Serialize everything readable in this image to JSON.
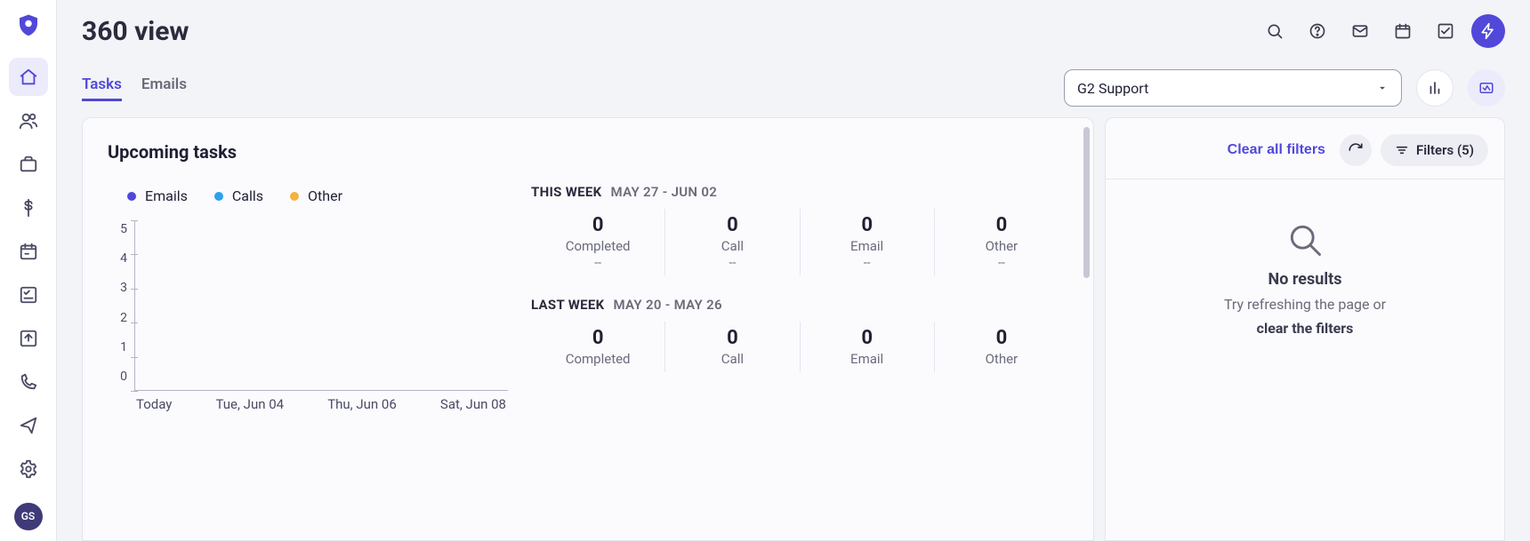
{
  "header": {
    "title": "360 view"
  },
  "avatar": {
    "initials": "GS"
  },
  "tabs": [
    {
      "id": "tasks",
      "label": "Tasks",
      "active": true
    },
    {
      "id": "emails",
      "label": "Emails",
      "active": false
    }
  ],
  "selector": {
    "value": "G2 Support"
  },
  "upcoming": {
    "title": "Upcoming tasks",
    "legend": {
      "emails": {
        "label": "Emails",
        "color": "#5148d9"
      },
      "calls": {
        "label": "Calls",
        "color": "#29a3ef"
      },
      "other": {
        "label": "Other",
        "color": "#f4b23e"
      }
    },
    "yticks": [
      "5",
      "4",
      "3",
      "2",
      "1",
      "0"
    ],
    "xlabels": [
      "Today",
      "Tue, Jun 04",
      "Thu, Jun 06",
      "Sat, Jun 08"
    ],
    "this_week": {
      "label": "THIS WEEK",
      "range": "MAY 27 - JUN 02",
      "stats": [
        {
          "num": "0",
          "lab": "Completed",
          "sub": "--"
        },
        {
          "num": "0",
          "lab": "Call",
          "sub": "--"
        },
        {
          "num": "0",
          "lab": "Email",
          "sub": "--"
        },
        {
          "num": "0",
          "lab": "Other",
          "sub": "--"
        }
      ]
    },
    "last_week": {
      "label": "LAST WEEK",
      "range": "MAY 20 - MAY 26",
      "stats": [
        {
          "num": "0",
          "lab": "Completed"
        },
        {
          "num": "0",
          "lab": "Call"
        },
        {
          "num": "0",
          "lab": "Email"
        },
        {
          "num": "0",
          "lab": "Other"
        }
      ]
    }
  },
  "filters": {
    "clear": "Clear all filters",
    "button": "Filters (5)",
    "noresults_title": "No results",
    "noresults_line": "Try refreshing the page or",
    "noresults_link": "clear the filters"
  },
  "chart_data": {
    "type": "bar",
    "title": "Upcoming tasks",
    "xlabel": "",
    "ylabel": "",
    "ylim": [
      0,
      5
    ],
    "categories": [
      "Today",
      "Tue, Jun 04",
      "Thu, Jun 06",
      "Sat, Jun 08"
    ],
    "series": [
      {
        "name": "Emails",
        "color": "#5148d9",
        "values": [
          0,
          0,
          0,
          0
        ]
      },
      {
        "name": "Calls",
        "color": "#29a3ef",
        "values": [
          0,
          0,
          0,
          0
        ]
      },
      {
        "name": "Other",
        "color": "#f4b23e",
        "values": [
          0,
          0,
          0,
          0
        ]
      }
    ]
  }
}
